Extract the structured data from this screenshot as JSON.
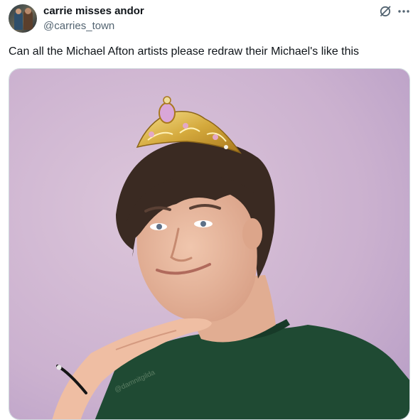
{
  "author": {
    "display_name": "carrie misses andor",
    "handle": "@carries_town",
    "avatar_icon": "profile-avatar"
  },
  "actions": {
    "grok_icon": "grok-icon",
    "more_icon": "more-dots-icon"
  },
  "post": {
    "text": "Can all the Michael Afton artists please redraw their Michael's like this"
  },
  "media": {
    "watermark": "@damnitgilda",
    "background_color": "#cdb3cf"
  },
  "colors": {
    "text_primary": "#0f1419",
    "text_secondary": "#536471",
    "border": "#cfd9de"
  }
}
